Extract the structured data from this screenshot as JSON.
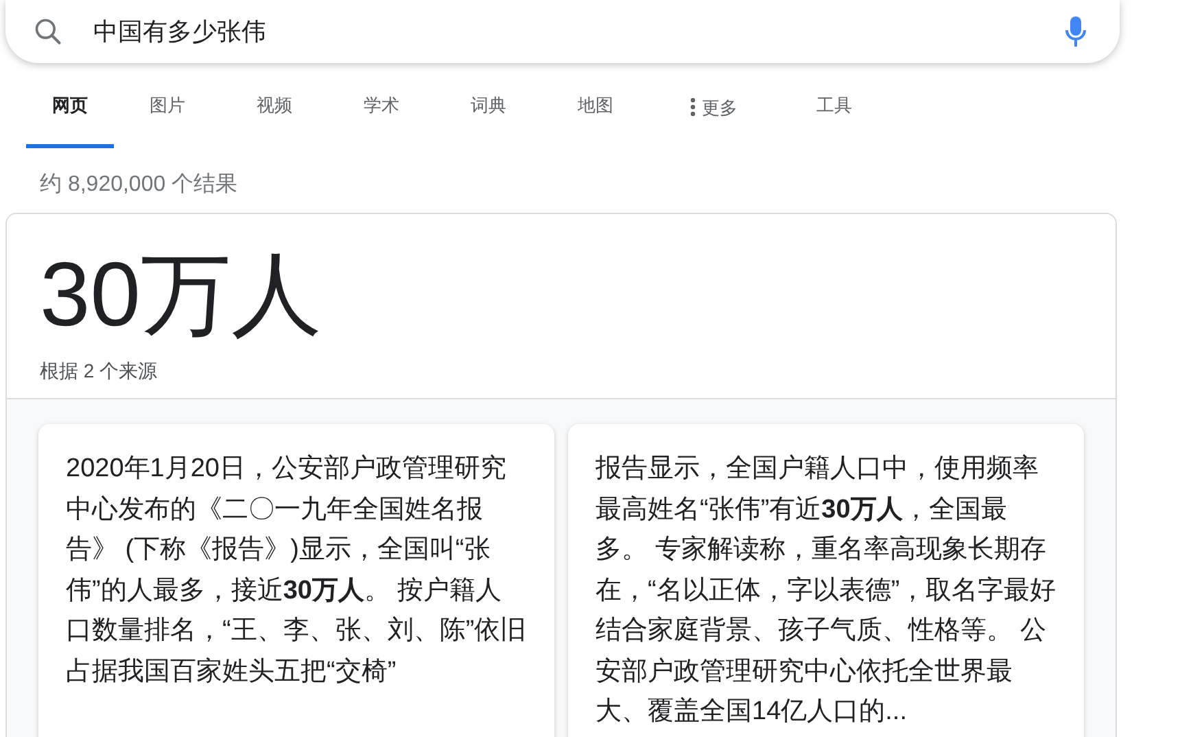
{
  "search": {
    "value": "中国有多少张伟"
  },
  "tabs": [
    {
      "label": "网页",
      "selected": true,
      "kind": "tab"
    },
    {
      "label": "图片",
      "selected": false,
      "kind": "tab"
    },
    {
      "label": "视频",
      "selected": false,
      "kind": "tab"
    },
    {
      "label": "学术",
      "selected": false,
      "kind": "tab"
    },
    {
      "label": "词典",
      "selected": false,
      "kind": "tab"
    },
    {
      "label": "地图",
      "selected": false,
      "kind": "tab"
    },
    {
      "label": "更多",
      "selected": false,
      "kind": "more"
    },
    {
      "label": "工具",
      "selected": false,
      "kind": "tools"
    }
  ],
  "result_count": "约 8,920,000 个结果",
  "answer": {
    "headline": "30万人",
    "sources": "根据 2 个来源",
    "cards": [
      {
        "text": "2020年1月20日，公安部户政管理研究中心发布的《二〇一九年全国姓名报告》 (下称《报告》)显示，全国叫“张伟”的人最多，接近**30万人**。 按户籍人口数量排名，“王、李、张、刘、陈”依旧占据我国百家姓头五把“交椅”"
      },
      {
        "text": "报告显示，全国户籍人口中，使用频率最高姓名“张伟”有近**30万人**，全国最多。 专家解读称，重名率高现象长期存在，“名以正体，字以表德”，取名字最好结合家庭背景、孩子气质、性格等。 公安部户政管理研究中心依托全世界最大、覆盖全国14亿人口的..."
      }
    ]
  }
}
